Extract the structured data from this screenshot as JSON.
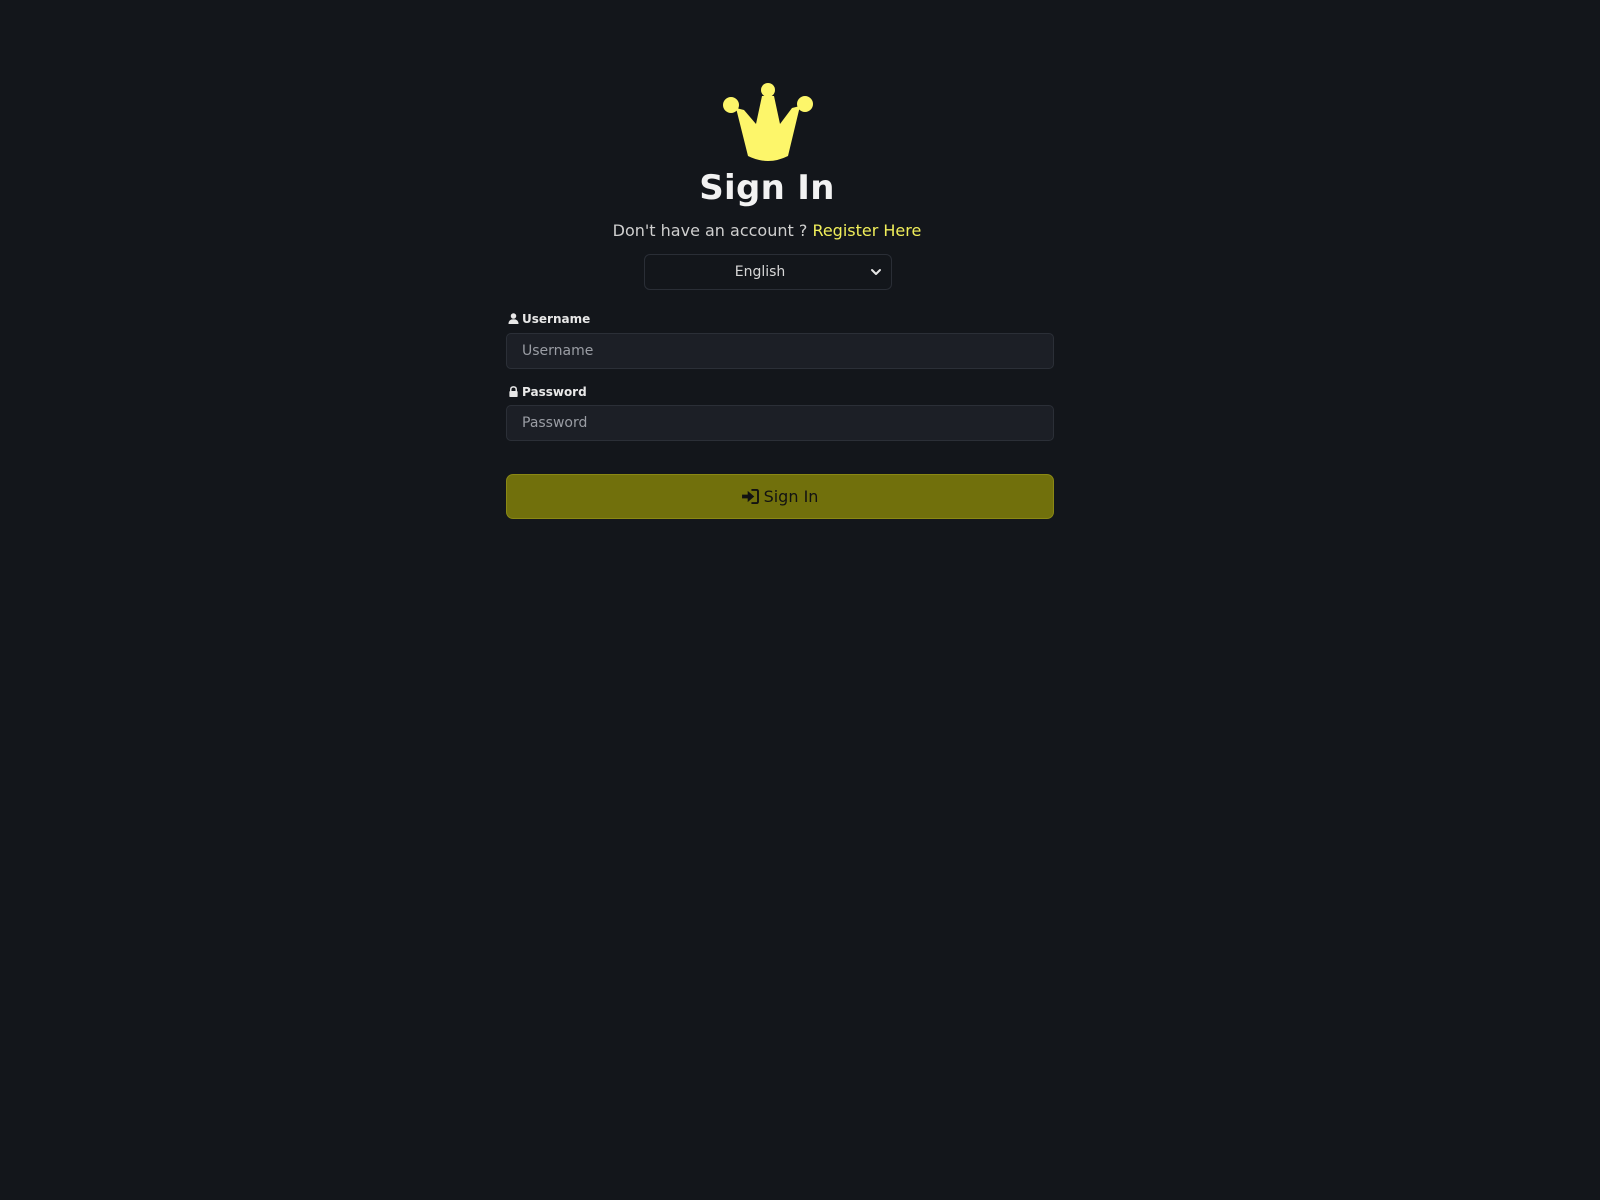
{
  "header": {
    "logo_icon": "crown-icon",
    "title": "Sign In",
    "register_prompt": "Don't have an account ?",
    "register_link": "Register Here"
  },
  "language": {
    "selected": "English",
    "icon": "chevron-down-icon"
  },
  "form": {
    "username": {
      "label": "Username",
      "placeholder": "Username",
      "value": "",
      "icon": "user-icon"
    },
    "password": {
      "label": "Password",
      "placeholder": "Password",
      "value": "",
      "icon": "lock-icon"
    },
    "submit_label": "Sign In",
    "submit_icon": "sign-in-icon"
  },
  "colors": {
    "background": "#13161b",
    "accent": "#f0ee5a",
    "button": "#71700c",
    "input_bg": "#1c1f26"
  }
}
